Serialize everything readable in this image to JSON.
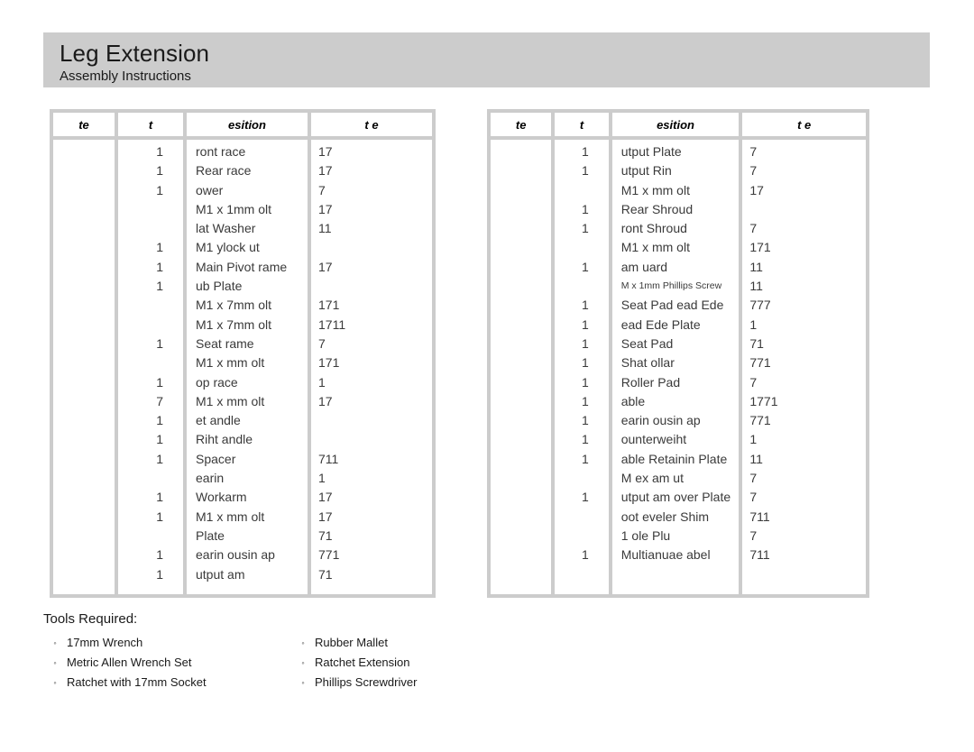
{
  "header": {
    "title": "Leg Extension",
    "subtitle": "Assembly Instructions",
    "band_color": "#cccccc"
  },
  "tables": {
    "columns": [
      "te",
      "t",
      "esition",
      "t e"
    ],
    "left": {
      "headers": [
        "te",
        "t",
        "esition",
        "t e"
      ],
      "rows": [
        {
          "item": "",
          "qty": "1",
          "desc": "ront race",
          "part": "17"
        },
        {
          "item": "",
          "qty": "1",
          "desc": "Rear race",
          "part": "17"
        },
        {
          "item": "",
          "qty": "1",
          "desc": "ower",
          "part": "7"
        },
        {
          "item": "",
          "qty": "",
          "desc": "M1 x 1mm olt",
          "part": "17"
        },
        {
          "item": "",
          "qty": "",
          "desc": " lat Washer",
          "part": "11"
        },
        {
          "item": "",
          "qty": "1",
          "desc": "M1 ylock ut",
          "part": ""
        },
        {
          "item": "",
          "qty": "1",
          "desc": "Main Pivot rame",
          "part": "17"
        },
        {
          "item": "",
          "qty": "1",
          "desc": "ub Plate",
          "part": ""
        },
        {
          "item": "",
          "qty": "",
          "desc": "M1 x 7mm olt",
          "part": "171"
        },
        {
          "item": "",
          "qty": "",
          "desc": "M1 x 7mm olt",
          "part": "1711"
        },
        {
          "item": "",
          "qty": "1",
          "desc": "Seat rame",
          "part": "7"
        },
        {
          "item": "",
          "qty": "",
          "desc": "M1 x mm olt",
          "part": "171"
        },
        {
          "item": "",
          "qty": "1",
          "desc": "op race",
          "part": "1"
        },
        {
          "item": "",
          "qty": "7",
          "desc": "M1 x mm olt",
          "part": "17"
        },
        {
          "item": "",
          "qty": "1",
          "desc": "et andle",
          "part": ""
        },
        {
          "item": "",
          "qty": "1",
          "desc": "Riht andle",
          "part": ""
        },
        {
          "item": "",
          "qty": "1",
          "desc": "Spacer",
          "part": "711"
        },
        {
          "item": "",
          "qty": "",
          "desc": "earin",
          "part": "1"
        },
        {
          "item": "",
          "qty": "1",
          "desc": "Workarm",
          "part": "17"
        },
        {
          "item": "",
          "qty": "1",
          "desc": "M1 x mm olt",
          "part": "17"
        },
        {
          "item": "",
          "qty": "",
          "desc": "Plate",
          "part": "71"
        },
        {
          "item": "",
          "qty": "1",
          "desc": "earin ousin ap",
          "part": "771"
        },
        {
          "item": "",
          "qty": "1",
          "desc": "utput am",
          "part": "71"
        }
      ]
    },
    "right": {
      "headers": [
        "te",
        "t",
        "esition",
        "t e"
      ],
      "rows": [
        {
          "item": "",
          "qty": "1",
          "desc": "utput Plate",
          "part": "7",
          "small": false
        },
        {
          "item": "",
          "qty": "1",
          "desc": "utput Rin",
          "part": "7",
          "small": false
        },
        {
          "item": "",
          "qty": "",
          "desc": "M1 x mm olt",
          "part": "17",
          "small": false
        },
        {
          "item": "",
          "qty": "1",
          "desc": "Rear Shroud",
          "part": "",
          "small": false
        },
        {
          "item": "",
          "qty": "1",
          "desc": "ront Shroud",
          "part": "7",
          "small": false
        },
        {
          "item": "",
          "qty": "",
          "desc": "M1 x mm olt",
          "part": "171",
          "small": false
        },
        {
          "item": "",
          "qty": "1",
          "desc": "am uard",
          "part": "11",
          "small": false
        },
        {
          "item": "",
          "qty": "",
          "desc": "M x 1mm Phillips Screw",
          "part": "11",
          "small": true
        },
        {
          "item": "",
          "qty": "1",
          "desc": "Seat Pad ead Ede",
          "part": "777",
          "small": false
        },
        {
          "item": "",
          "qty": "1",
          "desc": "ead Ede Plate",
          "part": "1",
          "small": false
        },
        {
          "item": "",
          "qty": "1",
          "desc": "Seat Pad",
          "part": "71",
          "small": false
        },
        {
          "item": "",
          "qty": "1",
          "desc": "Shat ollar",
          "part": "771",
          "small": false
        },
        {
          "item": "",
          "qty": "1",
          "desc": "Roller Pad",
          "part": "7",
          "small": false
        },
        {
          "item": "",
          "qty": "1",
          "desc": "able",
          "part": "1771",
          "small": false
        },
        {
          "item": "",
          "qty": "1",
          "desc": "earin ousin ap",
          "part": "771",
          "small": false
        },
        {
          "item": "",
          "qty": "1",
          "desc": "ounterweiht",
          "part": "1",
          "small": false
        },
        {
          "item": "",
          "qty": "1",
          "desc": "able Retainin Plate",
          "part": "11",
          "small": false
        },
        {
          "item": "",
          "qty": "",
          "desc": "M ex am ut",
          "part": "7",
          "small": false
        },
        {
          "item": "",
          "qty": "1",
          "desc": "utput am over Plate",
          "part": "7",
          "small": false
        },
        {
          "item": "",
          "qty": "",
          "desc": "oot eveler Shim",
          "part": "711",
          "small": false
        },
        {
          "item": "",
          "qty": "",
          "desc": "1 ole Plu",
          "part": "7",
          "small": false
        },
        {
          "item": "",
          "qty": "1",
          "desc": "Multianuae abel",
          "part": "711",
          "small": false
        }
      ]
    }
  },
  "tools": {
    "title": "Tools Required:",
    "bullet": "circle-bullet",
    "bullet_glyph": "◦",
    "column_left": [
      "17mm Wrench",
      "Metric Allen Wrench Set",
      "Ratchet with 17mm Socket"
    ],
    "column_right": [
      "Rubber Mallet",
      "Ratchet Extension",
      "Phillips Screwdriver"
    ]
  }
}
